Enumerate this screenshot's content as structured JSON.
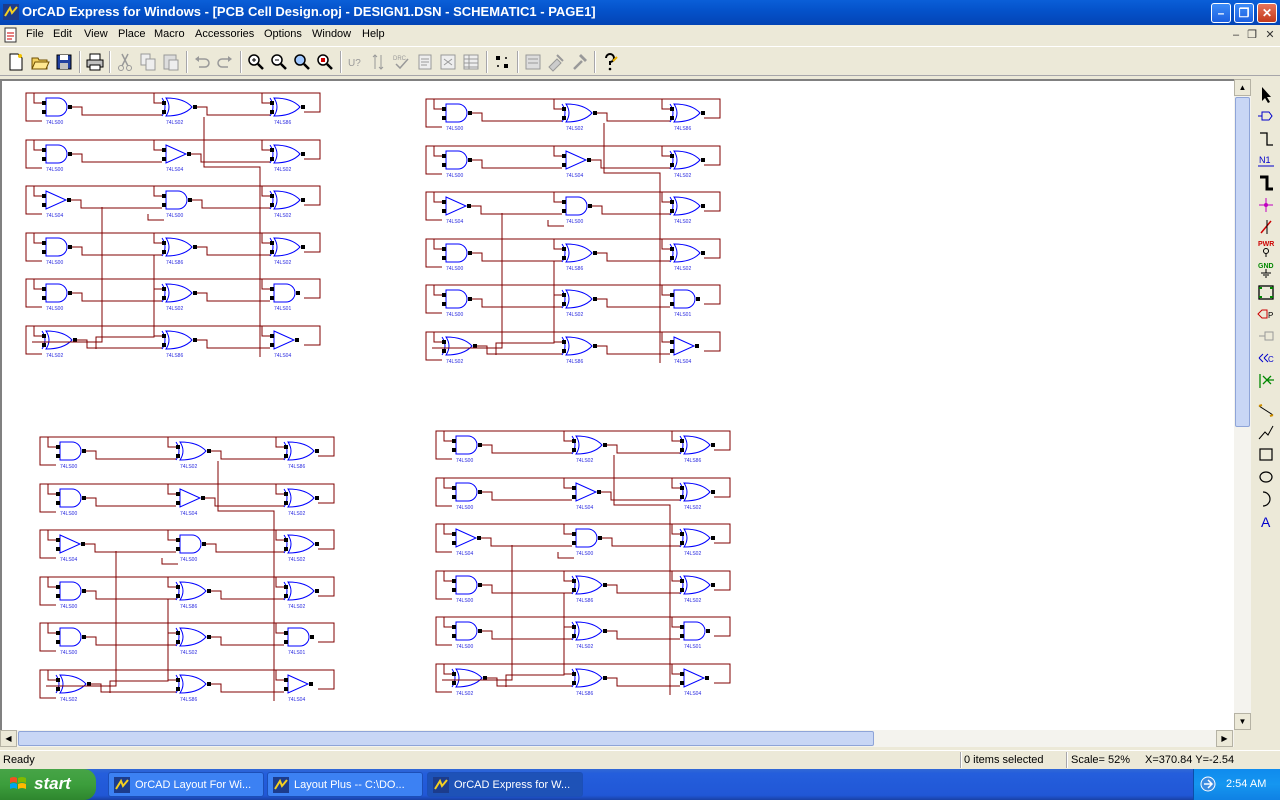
{
  "window": {
    "title": "OrCAD Express for Windows - [PCB Cell Design.opj - DESIGN1.DSN - SCHEMATIC1 - PAGE1]"
  },
  "menu": [
    "File",
    "Edit",
    "View",
    "Place",
    "Macro",
    "Accessories",
    "Options",
    "Window",
    "Help"
  ],
  "toolbar": {
    "icons": [
      "new-icon",
      "open-icon",
      "save-icon",
      "print-icon",
      "cut-icon",
      "copy-icon",
      "paste-icon",
      "undo-icon",
      "redo-icon",
      "zoom-in-icon",
      "zoom-out-icon",
      "zoom-area-icon",
      "zoom-all-icon",
      "annotate-icon",
      "back-annotate-icon",
      "drc-icon",
      "create-netlist-icon",
      "cross-reference-icon",
      "bill-of-materials-icon",
      "snap-to-grid-icon",
      "project-manager-icon",
      "part-editor-icon",
      "help-icon"
    ],
    "labels": {
      "u_question": "U?",
      "drc": "DRC"
    }
  },
  "palette": {
    "icons": [
      "select-tool-icon",
      "place-part-icon",
      "place-wire-icon",
      "place-net-alias-icon",
      "place-bus-icon",
      "place-junction-icon",
      "place-bus-entry-icon",
      "place-power-icon",
      "place-ground-icon",
      "place-hierarchical-block-icon",
      "place-port-icon",
      "place-pin-icon",
      "place-off-page-connector-icon",
      "place-no-connect-icon",
      "place-line-icon",
      "place-polyline-icon",
      "place-rectangle-icon",
      "place-ellipse-icon",
      "place-arc-icon",
      "place-text-icon"
    ],
    "labels": {
      "net_alias": "N1",
      "power": "PWR",
      "ground": "GND",
      "port": "P",
      "text": "A"
    }
  },
  "schematic": {
    "parts": {
      "and": "74LS00",
      "xor": "74LS02",
      "xor_alt": "74LS86",
      "buffer": "74LS04",
      "and_alt": "74LS01"
    }
  },
  "status": {
    "ready": "Ready",
    "selection": "0 items selected",
    "scale": "Scale= 52%",
    "coords": "X=370.84  Y=-2.54"
  },
  "taskbar": {
    "start": "start",
    "tasks": [
      "OrCAD Layout For Wi...",
      "Layout Plus -- C:\\DO...",
      "OrCAD Express for W..."
    ],
    "clock": "2:54 AM"
  },
  "colors": {
    "wire": "#800000",
    "part": "#0000FF",
    "part_label": "#2A2AE0",
    "pin": "#000000"
  }
}
